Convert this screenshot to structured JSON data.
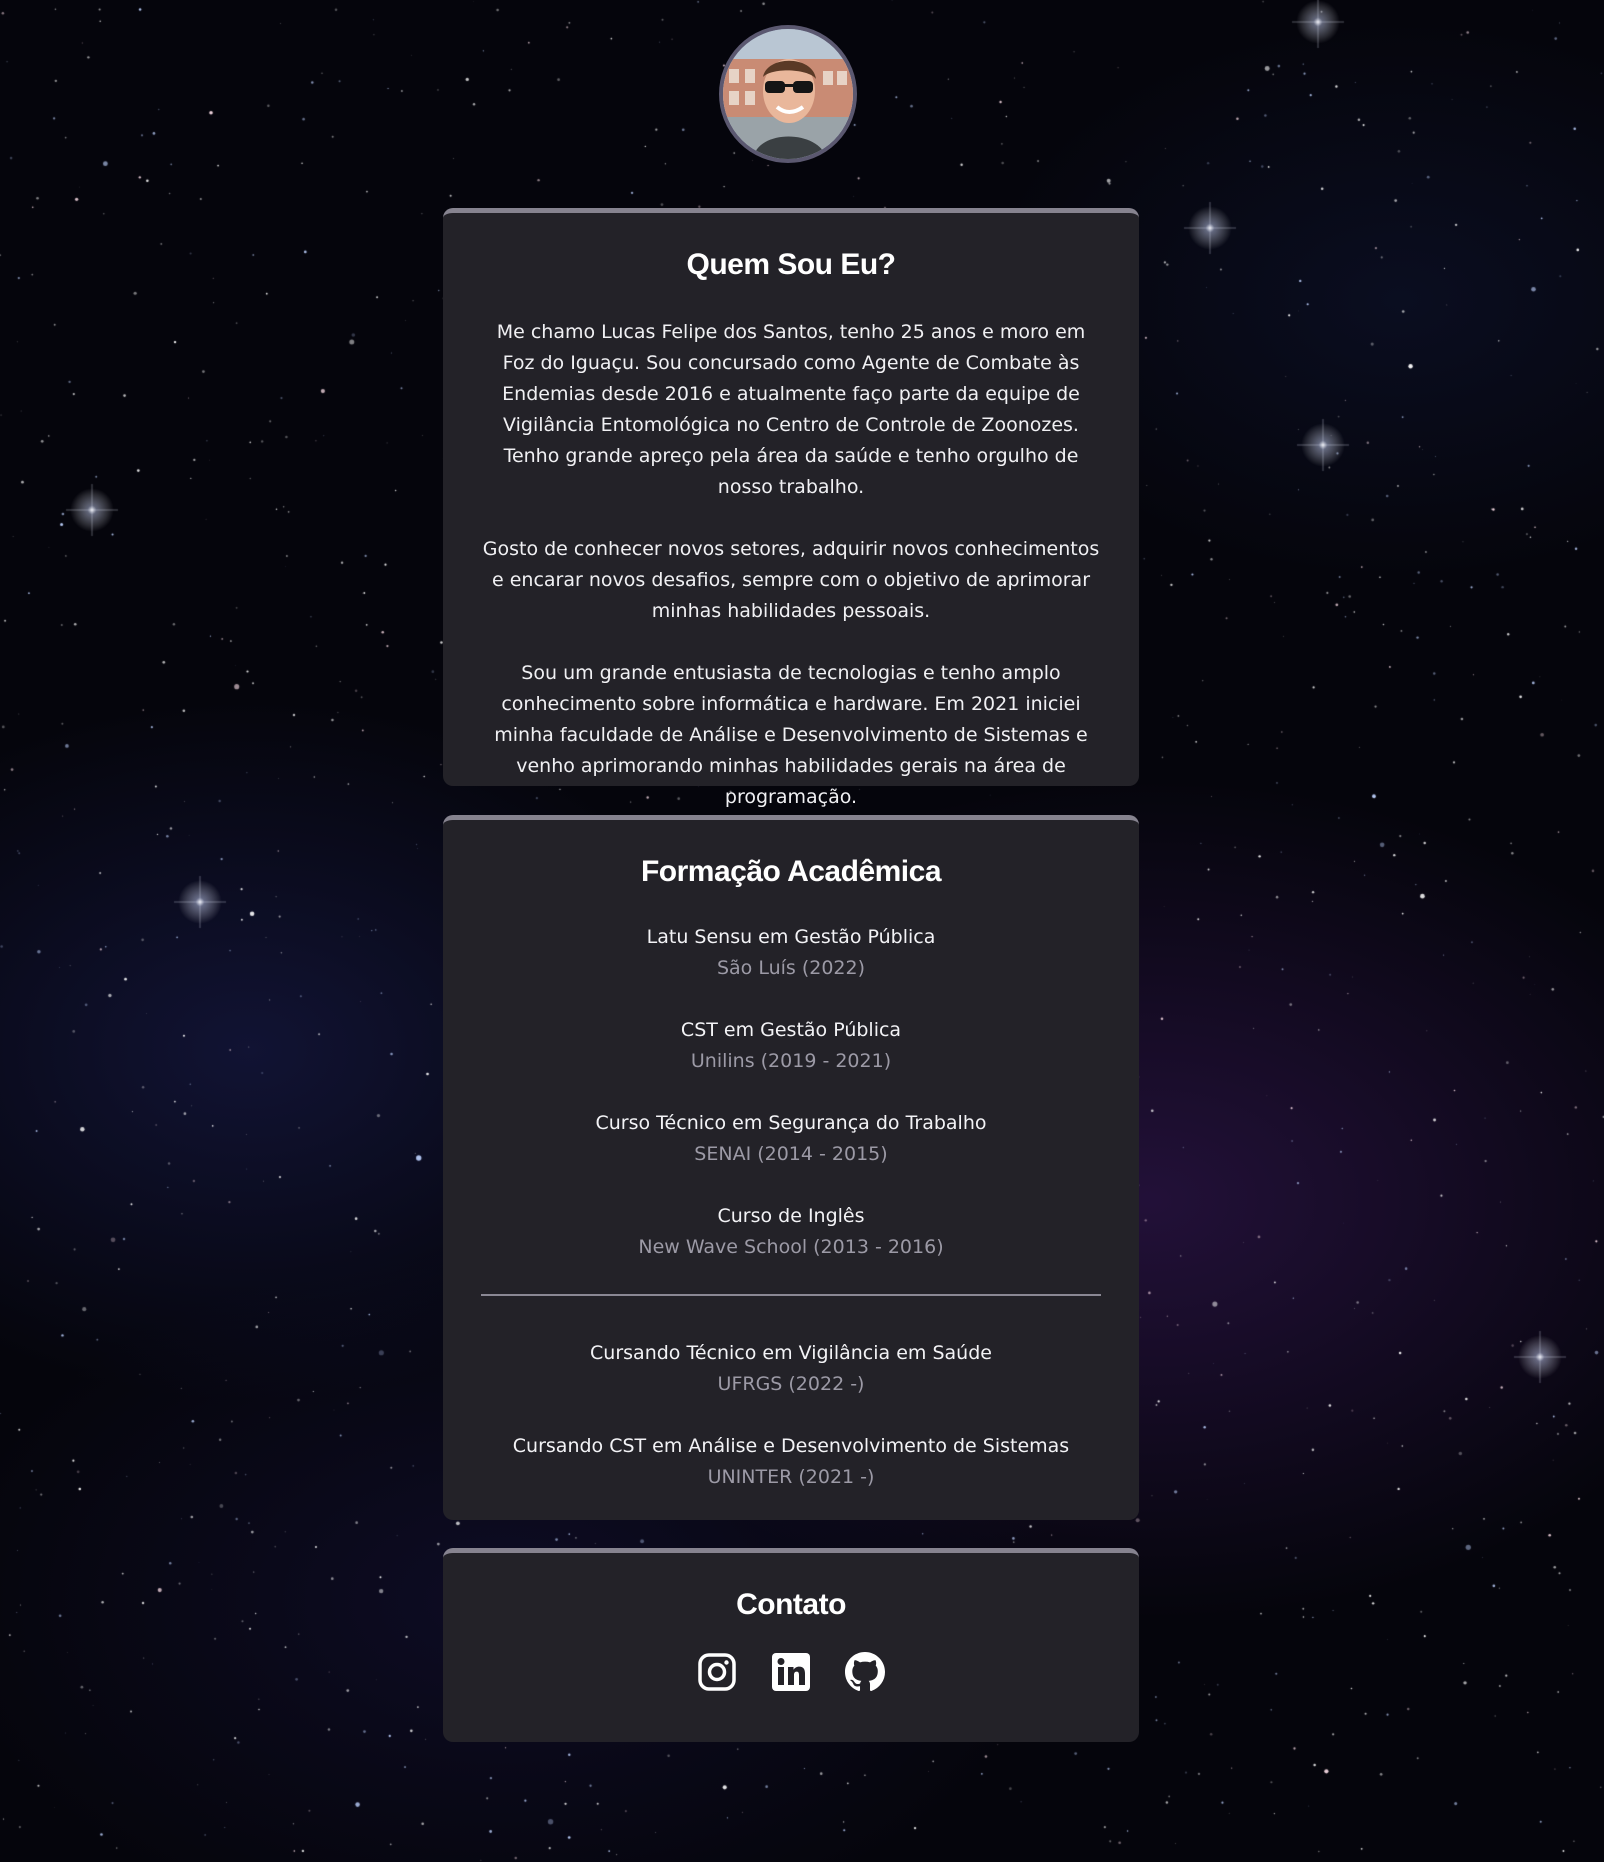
{
  "profile": {
    "avatar_alt": "Lucas Felipe dos Santos"
  },
  "about": {
    "title": "Quem Sou Eu?",
    "paragraphs": [
      "Me chamo Lucas Felipe dos Santos, tenho 25 anos e moro em Foz do Iguaçu. Sou concursado como Agente de Combate às Endemias desde 2016 e atualmente faço parte da equipe de Vigilância Entomológica no Centro de Controle de Zoonozes. Tenho grande apreço pela área da saúde e tenho orgulho de nosso trabalho.",
      "Gosto de conhecer novos setores, adquirir novos conhecimentos e encarar novos desafios, sempre com o objetivo de aprimorar minhas habilidades pessoais.",
      "Sou um grande entusiasta de tecnologias e tenho amplo conhecimento sobre informática e hardware. Em 2021 iniciei minha faculdade de Análise e Desenvolvimento de Sistemas e venho aprimorando minhas habilidades gerais na área de programação."
    ]
  },
  "education": {
    "title": "Formação Acadêmica",
    "completed": [
      {
        "course": "Latu Sensu em Gestão Pública",
        "institution": "São Luís (2022)"
      },
      {
        "course": "CST em Gestão Pública",
        "institution": "Unilins (2019 - 2021)"
      },
      {
        "course": "Curso Técnico em Segurança do Trabalho",
        "institution": "SENAI (2014 - 2015)"
      },
      {
        "course": "Curso de Inglês",
        "institution": "New Wave School (2013 - 2016)"
      }
    ],
    "in_progress": [
      {
        "course": "Cursando Técnico em Vigilância em Saúde",
        "institution": "UFRGS (2022 -)"
      },
      {
        "course": "Cursando CST em Análise e Desenvolvimento de Sistemas",
        "institution": "UNINTER (2021 -)"
      }
    ]
  },
  "contact": {
    "title": "Contato",
    "links": [
      {
        "icon": "instagram-icon"
      },
      {
        "icon": "linkedin-icon"
      },
      {
        "icon": "github-icon"
      }
    ]
  },
  "colors": {
    "background": "#05050c",
    "card": "#232228",
    "card_border": "#86838f",
    "muted_text": "#9c9aa6",
    "text": "#ffffff"
  }
}
